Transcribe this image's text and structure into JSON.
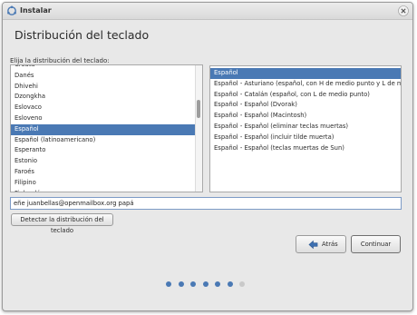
{
  "window": {
    "title": "Instalar"
  },
  "page": {
    "title": "Distribución del teclado",
    "prompt": "Elija la distribución del teclado:"
  },
  "languages": [
    "Croata",
    "Danés",
    "Dhivehi",
    "Dzongkha",
    "Eslovaco",
    "Esloveno",
    "Español",
    "Español (latinoamericano)",
    "Esperanto",
    "Estonio",
    "Faroés",
    "Filipino",
    "Finlandés"
  ],
  "selected_language_index": 6,
  "variants": [
    "Español",
    "Español - Asturiano (español, con H de medio punto y L de medio punto)",
    "Español - Catalán (español, con L de medio punto)",
    "Español - Español (Dvorak)",
    "Español - Español (Macintosh)",
    "Español - Español (eliminar teclas muertas)",
    "Español - Español (incluir tilde muerta)",
    "Español - Español (teclas muertas de Sun)"
  ],
  "selected_variant_index": 0,
  "test_input": {
    "value": "eñe juanbellas@openmailbox.org papá"
  },
  "buttons": {
    "detect": "Detectar la distribución del teclado",
    "back": "Atrás",
    "continue": "Continuar"
  },
  "progress": {
    "total_steps": 7,
    "current_step": 6
  },
  "colors": {
    "accent": "#4a79b4",
    "inactive_dot": "#c9c9c9"
  }
}
